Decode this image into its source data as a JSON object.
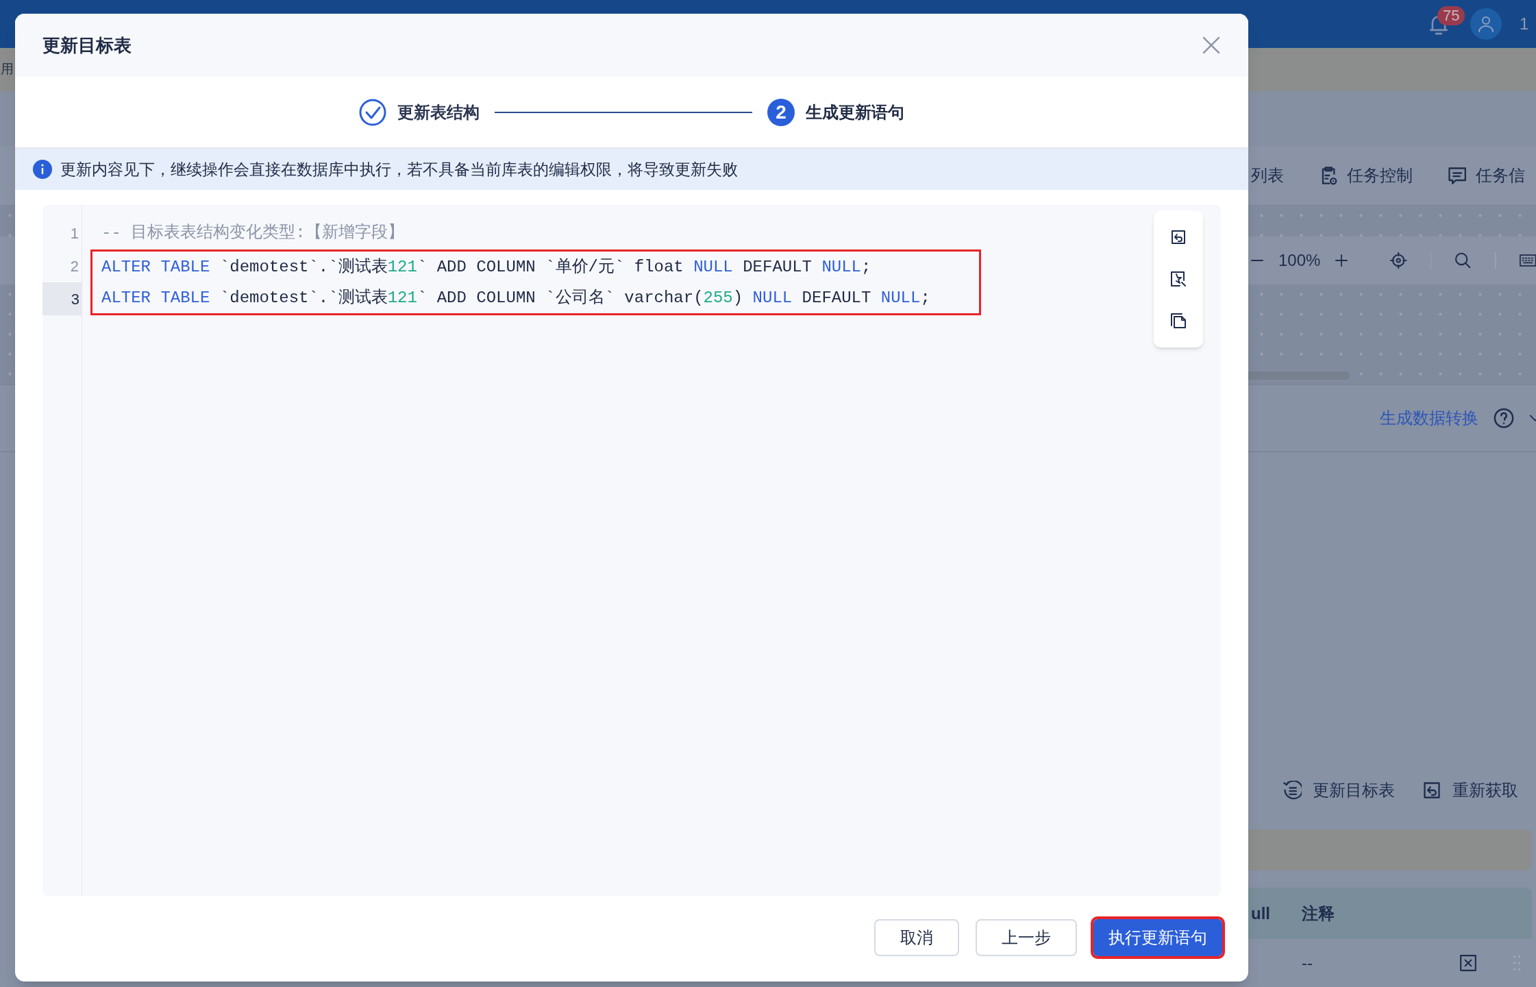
{
  "background": {
    "notification_count": "75",
    "user_label": "1",
    "side_text": "用",
    "toolbar": [
      {
        "label": "列表"
      },
      {
        "label": "任务控制"
      },
      {
        "label": "任务信"
      }
    ],
    "zoom": "100%",
    "link": "生成数据转换",
    "actions": [
      {
        "label": "更新目标表"
      },
      {
        "label": "重新获取"
      }
    ],
    "table": {
      "columns": [
        "ull",
        "注释"
      ],
      "rows": [
        [
          "",
          "--"
        ]
      ]
    }
  },
  "dialog": {
    "title": "更新目标表",
    "steps": [
      {
        "label": "更新表结构",
        "completed": true
      },
      {
        "label": "生成更新语句",
        "completed": false,
        "number": "2"
      }
    ],
    "notice": "更新内容见下，继续操作会直接在数据库中执行，若不具备当前库表的编辑权限，将导致更新失败",
    "code_lines": [
      {
        "number": "1",
        "active": false,
        "highlighted": false,
        "tokens": [
          {
            "kind": "comment",
            "text": "-- 目标表表结构变化类型:【新增字段】"
          }
        ]
      },
      {
        "number": "2",
        "active": false,
        "highlighted": true,
        "tokens": [
          {
            "kind": "keyword",
            "text": "ALTER TABLE"
          },
          {
            "kind": "plain",
            "text": " `demotest`.`测试表"
          },
          {
            "kind": "number",
            "text": "121"
          },
          {
            "kind": "plain",
            "text": "` ADD COLUMN `单价/元` float "
          },
          {
            "kind": "keyword",
            "text": "NULL"
          },
          {
            "kind": "plain",
            "text": " DEFAULT "
          },
          {
            "kind": "keyword",
            "text": "NULL"
          },
          {
            "kind": "plain",
            "text": ";"
          }
        ]
      },
      {
        "number": "3",
        "active": true,
        "highlighted": true,
        "tokens": [
          {
            "kind": "keyword",
            "text": "ALTER TABLE"
          },
          {
            "kind": "plain",
            "text": " `demotest`.`测试表"
          },
          {
            "kind": "number",
            "text": "121"
          },
          {
            "kind": "plain",
            "text": "` ADD COLUMN `公司名` varchar("
          },
          {
            "kind": "number",
            "text": "255"
          },
          {
            "kind": "plain",
            "text": ") "
          },
          {
            "kind": "keyword",
            "text": "NULL"
          },
          {
            "kind": "plain",
            "text": " DEFAULT "
          },
          {
            "kind": "keyword",
            "text": "NULL"
          },
          {
            "kind": "plain",
            "text": ";"
          }
        ]
      }
    ],
    "buttons": [
      {
        "label": "取消",
        "kind": "default",
        "highlighted": false
      },
      {
        "label": "上一步",
        "kind": "default",
        "highlighted": false
      },
      {
        "label": "执行更新语句",
        "kind": "primary",
        "highlighted": true
      }
    ]
  }
}
